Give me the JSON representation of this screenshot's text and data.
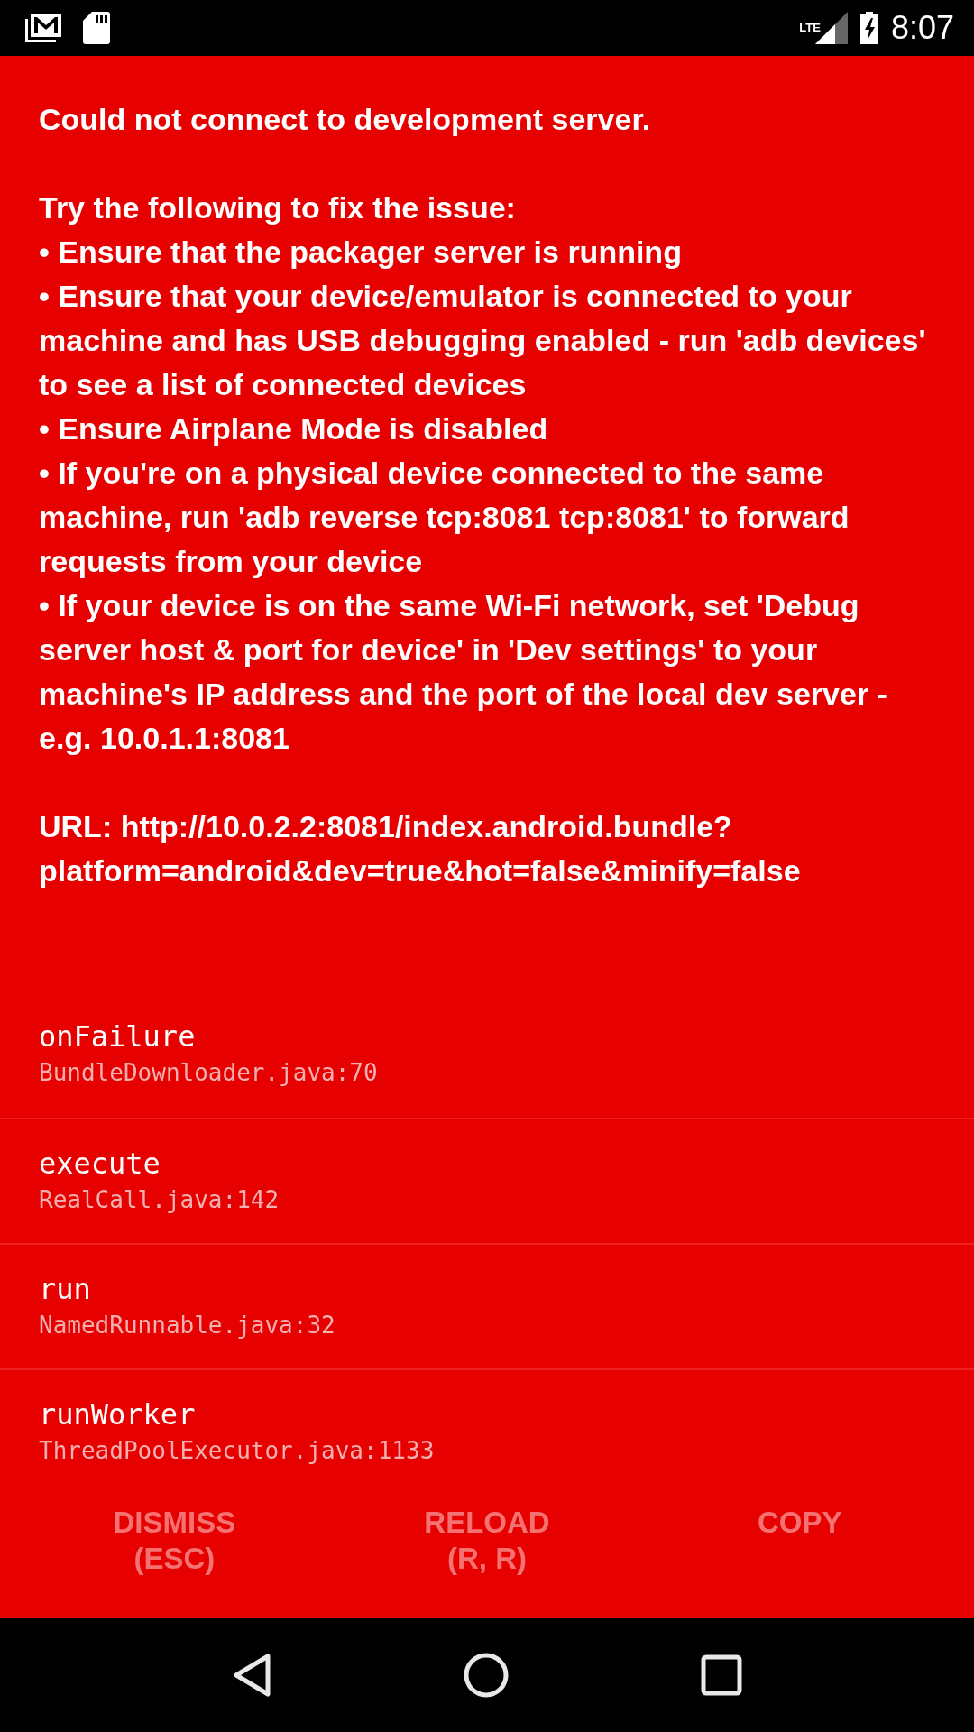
{
  "status_bar": {
    "network": "LTE",
    "time": "8:07"
  },
  "error": {
    "title": "Could not connect to development server.",
    "intro": "Try the following to fix the issue:",
    "tips": [
      "• Ensure that the packager server is running",
      "• Ensure that your device/emulator is connected to your machine and has USB debugging enabled - run 'adb devices' to see a list of connected devices",
      "• Ensure Airplane Mode is disabled",
      "• If you're on a physical device connected to the same machine, run 'adb reverse tcp:8081 tcp:8081' to forward requests from your device",
      "• If your device is on the same Wi-Fi network, set 'Debug server host & port for device' in 'Dev settings' to your machine's IP address and the port of the local dev server - e.g. 10.0.1.1:8081"
    ],
    "url": "URL: http://10.0.2.2:8081/index.android.bundle?platform=android&dev=true&hot=false&minify=false"
  },
  "stack": [
    {
      "method": "onFailure",
      "file": "BundleDownloader.java:70"
    },
    {
      "method": "execute",
      "file": "RealCall.java:142"
    },
    {
      "method": "run",
      "file": "NamedRunnable.java:32"
    },
    {
      "method": "runWorker",
      "file": "ThreadPoolExecutor.java:1133"
    }
  ],
  "buttons": [
    {
      "label": "DISMISS",
      "shortcut": "(ESC)"
    },
    {
      "label": "RELOAD",
      "shortcut": "(R, R)"
    },
    {
      "label": "COPY"
    }
  ]
}
